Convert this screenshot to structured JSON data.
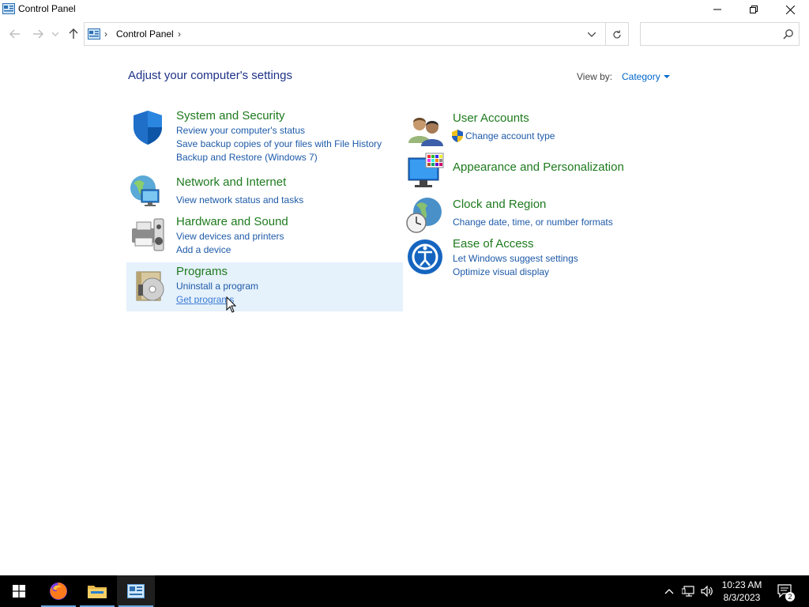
{
  "window": {
    "title": "Control Panel"
  },
  "addressbar": {
    "breadcrumb": "Control Panel",
    "separator": "›",
    "search_placeholder": ""
  },
  "content": {
    "heading": "Adjust your computer's settings",
    "view_by_label": "View by:",
    "view_by_value": "Category"
  },
  "categories": [
    {
      "title": "System and Security",
      "icon": "shield-icon",
      "links": [
        "Review your computer's status",
        "Save backup copies of your files with File History",
        "Backup and Restore (Windows 7)"
      ]
    },
    {
      "title": "Network and Internet",
      "icon": "network-globe-icon",
      "links": [
        "View network status and tasks"
      ]
    },
    {
      "title": "Hardware and Sound",
      "icon": "printer-speaker-icon",
      "links": [
        "View devices and printers",
        "Add a device"
      ]
    },
    {
      "title": "Programs",
      "icon": "programs-disc-icon",
      "links": [
        "Uninstall a program",
        "Get programs"
      ]
    },
    {
      "title": "User Accounts",
      "icon": "users-icon",
      "links": [
        "Change account type"
      ]
    },
    {
      "title": "Appearance and Personalization",
      "icon": "monitor-palette-icon",
      "links": []
    },
    {
      "title": "Clock and Region",
      "icon": "clock-globe-icon",
      "links": [
        "Change date, time, or number formats"
      ]
    },
    {
      "title": "Ease of Access",
      "icon": "ease-of-access-icon",
      "links": [
        "Let Windows suggest settings",
        "Optimize visual display"
      ]
    }
  ],
  "taskbar": {
    "time": "10:23 AM",
    "date": "8/3/2023",
    "notification_count": "2"
  },
  "colors": {
    "category_title": "#1e7a1e",
    "link": "#1e5aa8",
    "heading": "#1e3287",
    "highlight": "#e5f1fb",
    "taskbar": "#000000"
  }
}
